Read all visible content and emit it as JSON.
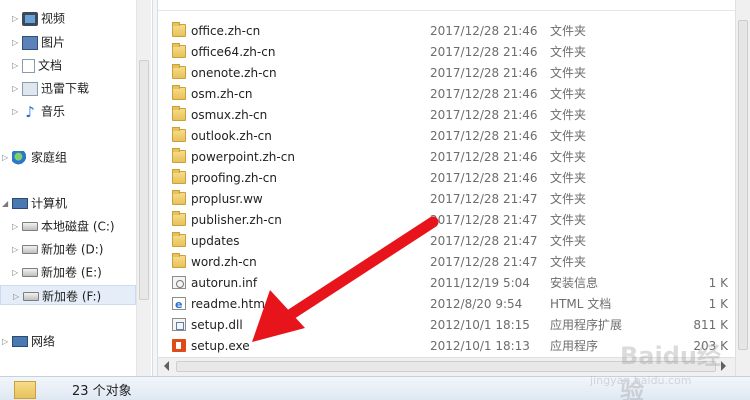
{
  "nav": {
    "items": [
      {
        "label": "视频",
        "icon": "video-library-icon"
      },
      {
        "label": "图片",
        "icon": "pictures-library-icon"
      },
      {
        "label": "文档",
        "icon": "documents-library-icon"
      },
      {
        "label": "迅雷下载",
        "icon": "downloads-icon"
      },
      {
        "label": "音乐",
        "icon": "music-library-icon"
      },
      {
        "label": "家庭组",
        "icon": "homegroup-icon"
      },
      {
        "label": "计算机",
        "icon": "computer-icon"
      },
      {
        "label": "本地磁盘 (C:)",
        "icon": "local-disk-icon"
      },
      {
        "label": "新加卷 (D:)",
        "icon": "drive-icon"
      },
      {
        "label": "新加卷 (E:)",
        "icon": "drive-icon"
      },
      {
        "label": "新加卷 (F:)",
        "icon": "drive-icon",
        "selected": true
      },
      {
        "label": "网络",
        "icon": "network-icon"
      }
    ]
  },
  "files": [
    {
      "name": "office.zh-cn",
      "date": "2017/12/28 21:46",
      "type": "文件夹",
      "size": "",
      "icon": "folder-icon"
    },
    {
      "name": "office64.zh-cn",
      "date": "2017/12/28 21:46",
      "type": "文件夹",
      "size": "",
      "icon": "folder-icon"
    },
    {
      "name": "onenote.zh-cn",
      "date": "2017/12/28 21:46",
      "type": "文件夹",
      "size": "",
      "icon": "folder-icon"
    },
    {
      "name": "osm.zh-cn",
      "date": "2017/12/28 21:46",
      "type": "文件夹",
      "size": "",
      "icon": "folder-icon"
    },
    {
      "name": "osmux.zh-cn",
      "date": "2017/12/28 21:46",
      "type": "文件夹",
      "size": "",
      "icon": "folder-icon"
    },
    {
      "name": "outlook.zh-cn",
      "date": "2017/12/28 21:46",
      "type": "文件夹",
      "size": "",
      "icon": "folder-icon"
    },
    {
      "name": "powerpoint.zh-cn",
      "date": "2017/12/28 21:46",
      "type": "文件夹",
      "size": "",
      "icon": "folder-icon"
    },
    {
      "name": "proofing.zh-cn",
      "date": "2017/12/28 21:46",
      "type": "文件夹",
      "size": "",
      "icon": "folder-icon"
    },
    {
      "name": "proplusr.ww",
      "date": "2017/12/28 21:47",
      "type": "文件夹",
      "size": "",
      "icon": "folder-icon"
    },
    {
      "name": "publisher.zh-cn",
      "date": "2017/12/28 21:47",
      "type": "文件夹",
      "size": "",
      "icon": "folder-icon"
    },
    {
      "name": "updates",
      "date": "2017/12/28 21:47",
      "type": "文件夹",
      "size": "",
      "icon": "folder-icon"
    },
    {
      "name": "word.zh-cn",
      "date": "2017/12/28 21:47",
      "type": "文件夹",
      "size": "",
      "icon": "folder-icon"
    },
    {
      "name": "autorun.inf",
      "date": "2011/12/19 5:04",
      "type": "安装信息",
      "size": "1 K",
      "icon": "setup-info-file-icon"
    },
    {
      "name": "readme.htm",
      "date": "2012/8/20 9:54",
      "type": "HTML 文档",
      "size": "1 K",
      "icon": "html-file-icon"
    },
    {
      "name": "setup.dll",
      "date": "2012/10/1 18:15",
      "type": "应用程序扩展",
      "size": "811 K",
      "icon": "dll-file-icon"
    },
    {
      "name": "setup.exe",
      "date": "2012/10/1 18:13",
      "type": "应用程序",
      "size": "203 K",
      "icon": "office-setup-icon"
    }
  ],
  "status": {
    "count": "23 个对象"
  },
  "watermark": {
    "text": "Baidu经验",
    "url": "jingyan.baidu.com"
  },
  "colors": {
    "annotation_arrow": "#e8141c",
    "selection": "#e5eef8",
    "folder": "#e8c15a"
  }
}
